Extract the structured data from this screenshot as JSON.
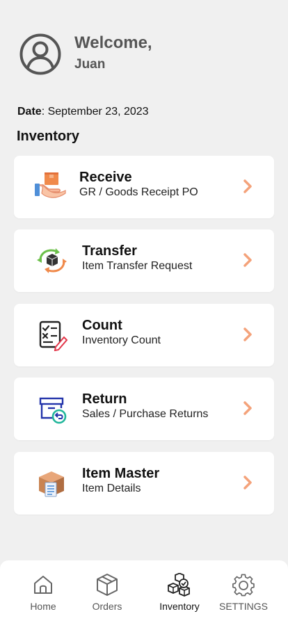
{
  "header": {
    "welcome": "Welcome,",
    "user_name": "Juan",
    "avatar_icon": "user-circle-icon"
  },
  "date": {
    "label": "Date",
    "value": ": September 23, 2023"
  },
  "section_title": "Inventory",
  "colors": {
    "background": "#f0f0f0",
    "card": "#ffffff",
    "chevron": "#f4a27a",
    "text": "#111111",
    "muted": "#555555"
  },
  "menu": [
    {
      "title": "Receive",
      "subtitle": "GR / Goods Receipt PO",
      "icon": "receive-box-hand-icon"
    },
    {
      "title": "Transfer",
      "subtitle": "Item Transfer Request",
      "icon": "transfer-cycle-icon"
    },
    {
      "title": "Count",
      "subtitle": "Inventory Count",
      "icon": "checklist-pencil-icon"
    },
    {
      "title": "Return",
      "subtitle": "Sales / Purchase Returns",
      "icon": "return-box-icon"
    },
    {
      "title": "Item Master",
      "subtitle": "Item Details",
      "icon": "item-box-document-icon"
    }
  ],
  "nav": [
    {
      "label": "Home",
      "icon": "home-icon"
    },
    {
      "label": "Orders",
      "icon": "box-icon"
    },
    {
      "label": "Inventory",
      "icon": "inventory-boxes-icon",
      "active": true
    },
    {
      "label": "SETTINGS",
      "icon": "gear-icon"
    }
  ]
}
